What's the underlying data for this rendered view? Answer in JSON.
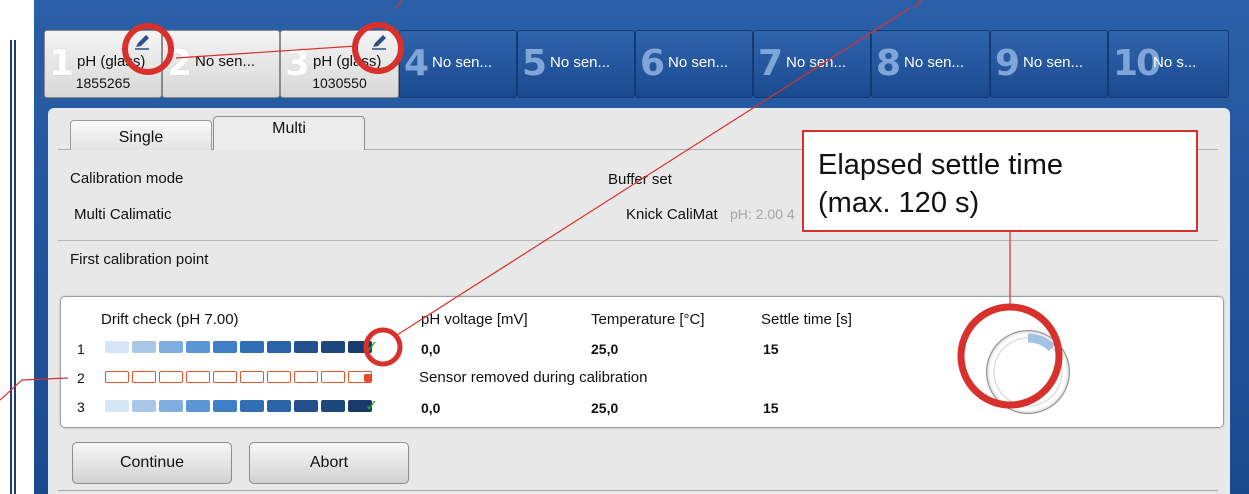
{
  "sensors": [
    {
      "num": "1",
      "name": "pH (glass)",
      "serial": "1855265",
      "active": true,
      "has_edit_icon": true
    },
    {
      "num": "2",
      "name": "No sen...",
      "serial": "",
      "active": true,
      "has_edit_icon": false
    },
    {
      "num": "3",
      "name": "pH (glass)",
      "serial": "1030550",
      "active": true,
      "has_edit_icon": true
    },
    {
      "num": "4",
      "name": "No sen...",
      "serial": "",
      "active": false,
      "has_edit_icon": false
    },
    {
      "num": "5",
      "name": "No sen...",
      "serial": "",
      "active": false,
      "has_edit_icon": false
    },
    {
      "num": "6",
      "name": "No sen...",
      "serial": "",
      "active": false,
      "has_edit_icon": false
    },
    {
      "num": "7",
      "name": "No sen...",
      "serial": "",
      "active": false,
      "has_edit_icon": false
    },
    {
      "num": "8",
      "name": "No sen...",
      "serial": "",
      "active": false,
      "has_edit_icon": false
    },
    {
      "num": "9",
      "name": "No sen...",
      "serial": "",
      "active": false,
      "has_edit_icon": false
    },
    {
      "num": "10",
      "name": "No s...",
      "serial": "",
      "active": false,
      "has_edit_icon": false
    }
  ],
  "tabs": {
    "single": "Single",
    "multi": "Multi"
  },
  "calibration": {
    "mode_label": "Calibration mode",
    "mode_value": "Multi Calimatic",
    "buffer_label": "Buffer set",
    "buffer_value": "Knick CaliMat",
    "buffer_ph": "pH: 2.00 4",
    "point_label": "First calibration point"
  },
  "drift": {
    "title": "Drift check (pH 7.00)",
    "col_voltage": "pH voltage [mV]",
    "col_temp": "Temperature [°C]",
    "col_settle": "Settle time [s]",
    "rows": [
      {
        "num": "1",
        "status": "ok",
        "voltage": "0,0",
        "temp": "25,0",
        "settle": "15",
        "message": ""
      },
      {
        "num": "2",
        "status": "error",
        "voltage": "",
        "temp": "",
        "settle": "",
        "message": "Sensor removed during calibration"
      },
      {
        "num": "3",
        "status": "ok",
        "voltage": "0,0",
        "temp": "25,0",
        "settle": "15",
        "message": ""
      }
    ],
    "bar_colors": [
      "#d6e6f6",
      "#a9c8e9",
      "#7eaddf",
      "#5c95d3",
      "#3f7fc6",
      "#2f6db5",
      "#2a63a7",
      "#234f8c",
      "#1e467f",
      "#183a6c"
    ],
    "error_color": "#e3552f",
    "ok_color": "#2aa02a"
  },
  "gauge": {
    "elapsed_s": 15,
    "max_s": 120,
    "fill_color": "#a3c3e6"
  },
  "buttons": {
    "continue": "Continue",
    "abort": "Abort"
  },
  "callout": {
    "line1": "Elapsed settle time",
    "line2": "(max. 120 s)",
    "border_color": "#d8302a"
  },
  "annotation_color": "#d8302a"
}
